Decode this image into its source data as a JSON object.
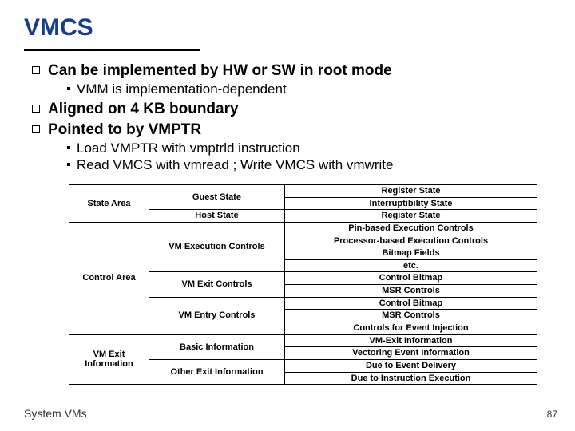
{
  "slide": {
    "title": "VMCS",
    "bullets": [
      {
        "text": "Can be implemented by HW or SW in root mode",
        "sub": [
          "VMM is implementation-dependent"
        ]
      },
      {
        "text": "Aligned on 4 KB boundary",
        "sub": []
      },
      {
        "text": "Pointed to by VMPTR",
        "sub": [
          "Load VMPTR with vmptrld instruction",
          "Read VMCS with vmread ; Write VMCS with vmwrite"
        ]
      }
    ],
    "table": {
      "col1": [
        "State Area",
        "Control Area",
        "VM Exit Information"
      ],
      "col2": [
        "Guest State",
        "Host State",
        "VM Execution Controls",
        "VM Exit Controls",
        "VM Entry Controls",
        "Basic Information",
        "Other Exit Information"
      ],
      "col3": [
        "Register State",
        "Interruptibility State",
        "Register State",
        "Pin-based Execution Controls",
        "Processor-based Execution Controls",
        "Bitmap Fields",
        "etc.",
        "Control Bitmap",
        "MSR Controls",
        "Control Bitmap",
        "MSR Controls",
        "Controls for Event Injection",
        "VM-Exit Information",
        "Vectoring Event Information",
        "Due to Event Delivery",
        "Due to Instruction Execution"
      ]
    },
    "footer_left": "System VMs",
    "footer_right": "87"
  }
}
